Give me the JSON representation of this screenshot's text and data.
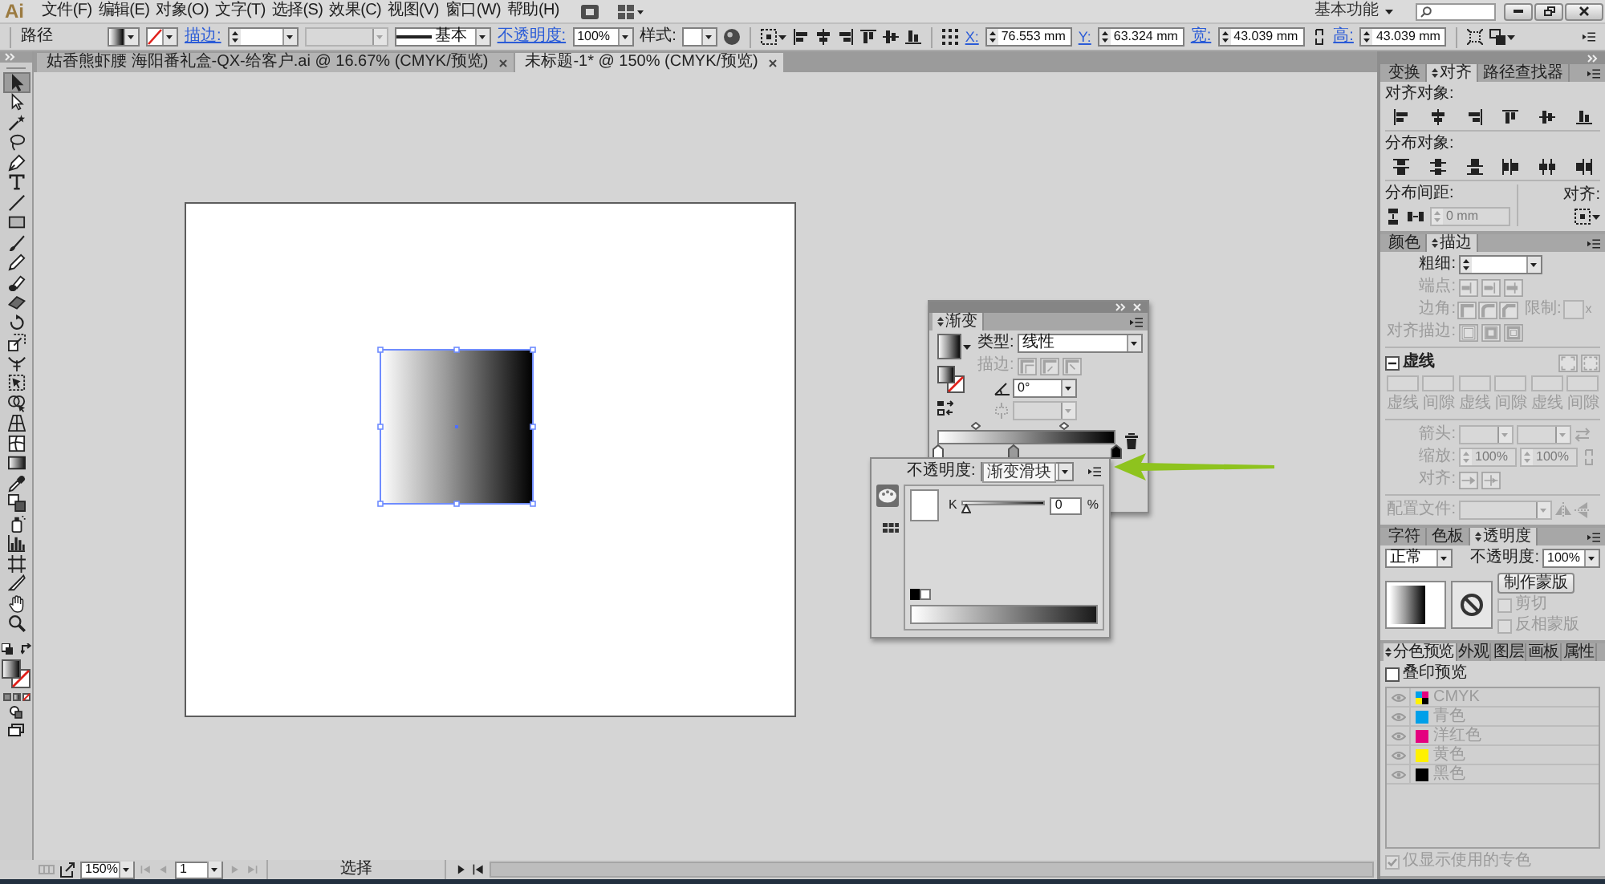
{
  "menu_bar": {
    "logo": "Ai",
    "items": [
      "文件(F)",
      "编辑(E)",
      "对象(O)",
      "文字(T)",
      "选择(S)",
      "效果(C)",
      "视图(V)",
      "窗口(W)",
      "帮助(H)"
    ],
    "workspace": "基本功能"
  },
  "control_bar": {
    "selection_type": "路径",
    "stroke_label": "描边:",
    "profile_disabled": true,
    "brush": "基本",
    "opacity_label": "不透明度:",
    "opacity": "100%",
    "style_label": "样式:",
    "x_label": "X:",
    "x": "76.553 mm",
    "y_label": "Y:",
    "y": "63.324 mm",
    "width_label": "宽:",
    "width": "43.039 mm",
    "height_label": "高:",
    "height": "43.039 mm"
  },
  "document_tabs": [
    {
      "title": "姑香熊虾腰 海阳番礼盒-QX-给客户.ai @ 16.67% (CMYK/预览)",
      "selected": false
    },
    {
      "title": "未标题-1* @ 150% (CMYK/预览)",
      "selected": true
    }
  ],
  "tools": [
    {
      "kind": "selection",
      "selected": true
    },
    {
      "kind": "direct",
      "selected": false
    },
    {
      "kind": "wand",
      "selected": false
    },
    {
      "kind": "lasso",
      "selected": false
    },
    {
      "kind": "pen",
      "selected": false
    },
    {
      "kind": "type",
      "selected": false
    },
    {
      "kind": "line",
      "selected": false
    },
    {
      "kind": "rectangle",
      "selected": false
    },
    {
      "kind": "brush",
      "selected": false
    },
    {
      "kind": "pencil",
      "selected": false
    },
    {
      "kind": "blob",
      "selected": false
    },
    {
      "kind": "eraser",
      "selected": false
    },
    {
      "kind": "rotate",
      "selected": false
    },
    {
      "kind": "scale",
      "selected": false
    },
    {
      "kind": "width",
      "selected": false
    },
    {
      "kind": "transform",
      "selected": false
    },
    {
      "kind": "builder",
      "selected": false
    },
    {
      "kind": "perspective",
      "selected": false
    },
    {
      "kind": "mesh",
      "selected": false
    },
    {
      "kind": "gradient",
      "selected": false
    },
    {
      "kind": "eyedropper",
      "selected": false
    },
    {
      "kind": "blend",
      "selected": false
    },
    {
      "kind": "sprayer",
      "selected": false
    },
    {
      "kind": "graph",
      "selected": false
    },
    {
      "kind": "artboard",
      "selected": false
    },
    {
      "kind": "slice",
      "selected": false
    },
    {
      "kind": "hand",
      "selected": false
    },
    {
      "kind": "zoom",
      "selected": false
    }
  ],
  "gradient_panel": {
    "tabs": [
      {
        "label": "渐变",
        "selected": true
      }
    ],
    "type_label": "类型:",
    "type": "线性",
    "stroke_label": "描边:",
    "stroke_disabled": true,
    "angle": "0°",
    "aspect_disabled": true,
    "stops": [
      {
        "color": "#ffffff",
        "level": 0
      },
      {
        "color": "#9a9a9a",
        "level": 0.43
      },
      {
        "color": "#000000",
        "level": 1
      }
    ]
  },
  "stop_popup": {
    "opacity_label": "不透明度:",
    "tooltip": "渐变滑块",
    "modes": [
      {
        "kind": "color",
        "selected": true
      },
      {
        "kind": "swatches",
        "selected": false
      }
    ],
    "channel": "K",
    "level": 0,
    "value": "0",
    "unit": "%"
  },
  "align_panel": {
    "tabs": [
      {
        "label": "变换",
        "selected": false
      },
      {
        "label": "对齐",
        "selected": true
      },
      {
        "label": "路径查找器",
        "selected": false
      }
    ],
    "align_objects_label": "对齐对象:",
    "distribute_objects_label": "分布对象:",
    "distribute_spacing_label": "分布间距:",
    "spacing": "0 mm",
    "spacing_disabled": true,
    "align_to_label": "对齐:"
  },
  "stroke_panel": {
    "tabs": [
      {
        "label": "颜色",
        "selected": false
      },
      {
        "label": "描边",
        "selected": true
      }
    ],
    "weight_label": "粗细:",
    "options_disabled": true,
    "cap_label": "端点:",
    "corner_label": "边角:",
    "limit_label": "限制:",
    "limit_unit": "x",
    "align_label": "对齐描边:",
    "dashed_label": "虚线",
    "dash_labels": [
      "虚线",
      "间隙",
      "虚线",
      "间隙",
      "虚线",
      "间隙"
    ],
    "arrowheads_label": "箭头:",
    "scale_label": "缩放:",
    "scale_start": "100%",
    "scale_end": "100%",
    "arrow_align_label": "对齐:",
    "profile_label": "配置文件:"
  },
  "transparency_panel": {
    "tabs": [
      {
        "label": "字符",
        "selected": false
      },
      {
        "label": "色板",
        "selected": false
      },
      {
        "label": "透明度",
        "selected": true
      }
    ],
    "blend_mode": "正常",
    "opacity_label": "不透明度:",
    "opacity": "100%",
    "mask_button": "制作蒙版",
    "options": [
      {
        "label": "剪切",
        "checked": false,
        "disabled": true
      },
      {
        "label": "反相蒙版",
        "checked": false,
        "disabled": true
      }
    ]
  },
  "separations_panel": {
    "tabs": [
      {
        "label": "分色预览",
        "selected": true
      },
      {
        "label": "外观",
        "selected": false
      },
      {
        "label": "图层",
        "selected": false
      },
      {
        "label": "画板",
        "selected": false
      },
      {
        "label": "属性",
        "selected": false
      }
    ],
    "overprint": {
      "label": "叠印预览",
      "checked": false
    },
    "inks": [
      {
        "kind": "process",
        "name": "CMYK",
        "visible": true,
        "disabled": true
      },
      {
        "kind": "ink",
        "name": "青色",
        "color": "#00a0e9",
        "visible": true,
        "disabled": true
      },
      {
        "kind": "ink",
        "name": "洋红色",
        "color": "#e4007f",
        "visible": true,
        "disabled": true
      },
      {
        "kind": "ink",
        "name": "黄色",
        "color": "#fff100",
        "visible": true,
        "disabled": true
      },
      {
        "kind": "ink",
        "name": "黑色",
        "color": "#000000",
        "visible": true,
        "disabled": true
      }
    ],
    "spot_only": {
      "label": "仅显示使用的专色",
      "checked": true,
      "disabled": true
    }
  },
  "status_bar": {
    "zoom": "150%",
    "artboard": "1",
    "tool": "选择"
  }
}
